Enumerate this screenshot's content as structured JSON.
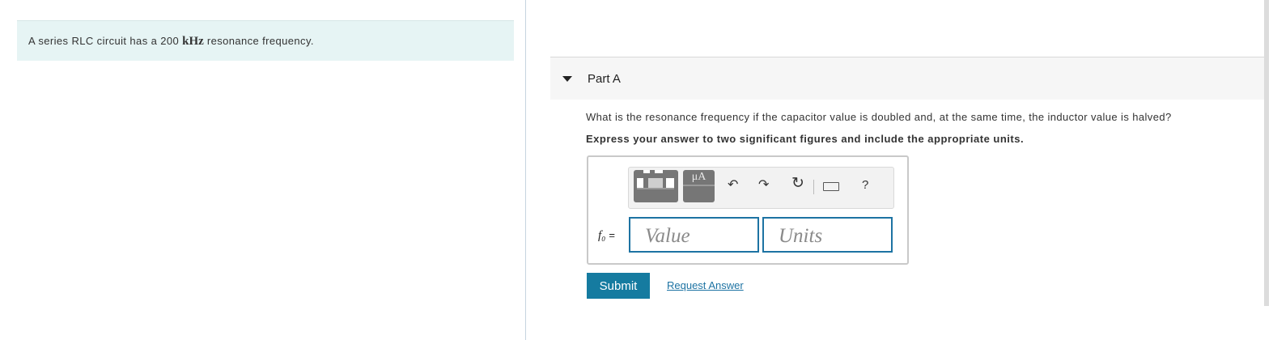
{
  "problem": {
    "text_before": "A series RLC circuit has a 200 ",
    "unit": "kHz",
    "text_after": " resonance frequency."
  },
  "part": {
    "title": "Part A",
    "question": "What is the resonance frequency if the capacitor value is doubled and, at the same time, the inductor value is halved?",
    "instruction": "Express your answer to two significant figures and include the appropriate units."
  },
  "toolbar": {
    "units_button_label": "μA",
    "help_label": "?",
    "icons": [
      "templates-icon",
      "units-icon",
      "undo-icon",
      "redo-icon",
      "reset-icon",
      "keyboard-icon",
      "help-icon"
    ]
  },
  "answer": {
    "variable": "f₀",
    "equals": "=",
    "value_placeholder": "Value",
    "units_placeholder": "Units"
  },
  "actions": {
    "submit_label": "Submit",
    "request_answer_label": "Request Answer"
  },
  "colors": {
    "accent": "#157ba0",
    "problem_background": "#e6f4f4",
    "input_border": "#1d73a3"
  }
}
